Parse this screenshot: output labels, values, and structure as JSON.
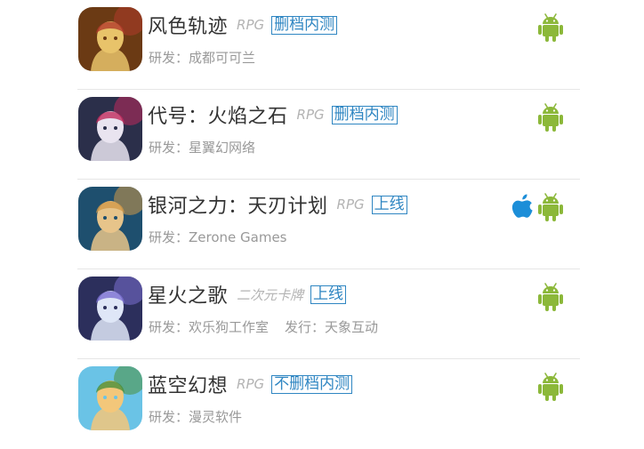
{
  "games": [
    {
      "name": "风色轨迹",
      "genre": "RPG",
      "status": "删档内测",
      "developer": "研发：成都可可兰",
      "publisher": "",
      "platforms": [
        "android"
      ],
      "thumb_colors": [
        "#6b3a14",
        "#e8c36a",
        "#b13b2a"
      ]
    },
    {
      "name": "代号：火焰之石",
      "genre": "RPG",
      "status": "删档内测",
      "developer": "研发：星翼幻网络",
      "publisher": "",
      "platforms": [
        "android"
      ],
      "thumb_colors": [
        "#2b2f4a",
        "#e9e4f0",
        "#c02a5c"
      ]
    },
    {
      "name": "银河之力：天刃计划",
      "genre": "RPG",
      "status": "上线",
      "developer": "研发：Zerone Games",
      "publisher": "",
      "platforms": [
        "ios",
        "android"
      ],
      "thumb_colors": [
        "#1e4f6e",
        "#e7c48a",
        "#d29a48"
      ]
    },
    {
      "name": "星火之歌",
      "genre": "二次元卡牌",
      "status": "上线",
      "developer": "研发：欢乐狗工作室",
      "publisher": "发行：天象互动",
      "platforms": [
        "android"
      ],
      "thumb_colors": [
        "#2c2f5c",
        "#dfe6f7",
        "#7b6fd1"
      ]
    },
    {
      "name": "蓝空幻想",
      "genre": "RPG",
      "status": "不删档内测",
      "developer": "研发：漫灵软件",
      "publisher": "",
      "platforms": [
        "android"
      ],
      "thumb_colors": [
        "#6ac3e6",
        "#f3c77a",
        "#4a8f3a"
      ]
    }
  ],
  "colors": {
    "status_blue": "#2f86c2",
    "android_green": "#8cb83a",
    "apple_blue": "#1c8ed8"
  }
}
